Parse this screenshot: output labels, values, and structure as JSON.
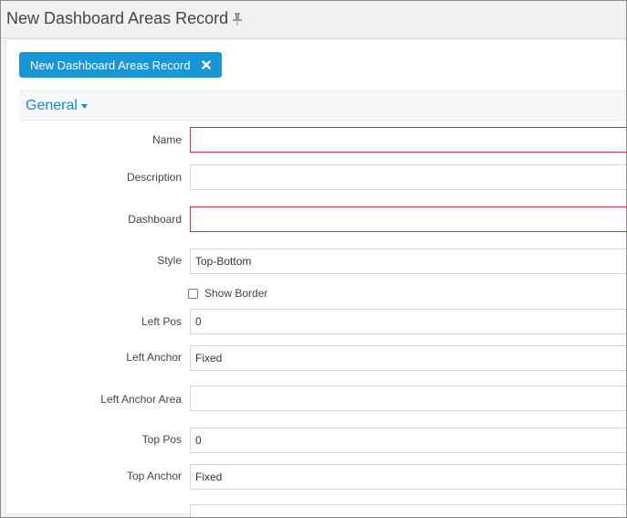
{
  "window": {
    "title": "New Dashboard Areas Record"
  },
  "tab": {
    "label": "New Dashboard Areas Record"
  },
  "section": {
    "title": "General"
  },
  "fields": {
    "name": {
      "label": "Name",
      "value": ""
    },
    "description": {
      "label": "Description",
      "value": ""
    },
    "dashboard": {
      "label": "Dashboard",
      "value": ""
    },
    "style": {
      "label": "Style",
      "value": "Top-Bottom"
    },
    "show_border": {
      "label": "Show Border",
      "checked": false
    },
    "left_pos": {
      "label": "Left Pos",
      "value": "0"
    },
    "left_anchor": {
      "label": "Left Anchor",
      "value": "Fixed"
    },
    "left_anchor_area": {
      "label": "Left Anchor Area",
      "value": ""
    },
    "top_pos": {
      "label": "Top Pos",
      "value": "0"
    },
    "top_anchor": {
      "label": "Top Anchor",
      "value": "Fixed"
    }
  },
  "colors": {
    "accent": "#1a95d6",
    "required_border": "#c9303a",
    "section_text": "#1a8ad0"
  },
  "icons": {
    "pin": "pin-icon",
    "close": "close-icon",
    "caret": "caret-down-icon"
  }
}
